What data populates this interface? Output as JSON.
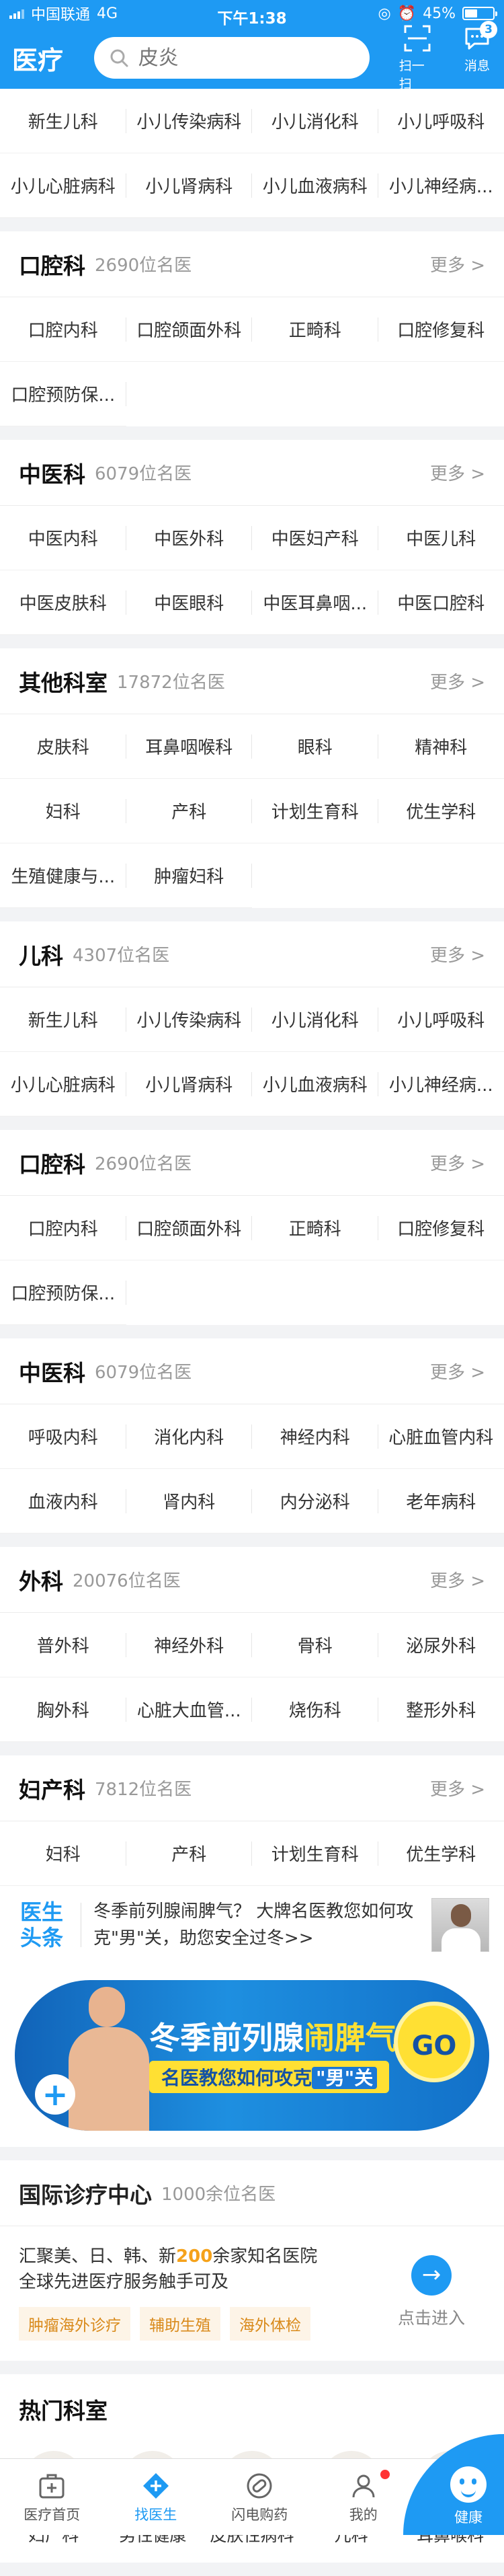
{
  "status_bar": {
    "carrier": "中国联通",
    "network": "4G",
    "time": "下午1:38",
    "battery": "45%"
  },
  "header": {
    "title": "医疗",
    "search_placeholder": "皮炎",
    "scan_label": "扫一扫",
    "message_label": "消息",
    "message_badge": "3"
  },
  "top_depts": [
    "新生儿科",
    "小儿传染病科",
    "小儿消化科",
    "小儿呼吸科",
    "小儿心脏病科",
    "小儿肾病科",
    "小儿血液病科",
    "小儿神经病..."
  ],
  "sections": [
    {
      "title": "口腔科",
      "count": "2690位名医",
      "more": "更多 >",
      "items": [
        "口腔内科",
        "口腔颌面外科",
        "正畸科",
        "口腔修复科",
        "口腔预防保..."
      ]
    },
    {
      "title": "中医科",
      "count": "6079位名医",
      "more": "更多 >",
      "items": [
        "中医内科",
        "中医外科",
        "中医妇产科",
        "中医儿科",
        "中医皮肤科",
        "中医眼科",
        "中医耳鼻咽...",
        "中医口腔科"
      ]
    },
    {
      "title": "其他科室",
      "count": "17872位名医",
      "more": "更多 >",
      "items": [
        "皮肤科",
        "耳鼻咽喉科",
        "眼科",
        "精神科",
        "妇科",
        "产科",
        "计划生育科",
        "优生学科",
        "生殖健康与...",
        "肿瘤妇科"
      ]
    },
    {
      "title": "儿科",
      "count": "4307位名医",
      "more": "更多 >",
      "items": [
        "新生儿科",
        "小儿传染病科",
        "小儿消化科",
        "小儿呼吸科",
        "小儿心脏病科",
        "小儿肾病科",
        "小儿血液病科",
        "小儿神经病..."
      ]
    },
    {
      "title": "口腔科",
      "count": "2690位名医",
      "more": "更多 >",
      "items": [
        "口腔内科",
        "口腔颌面外科",
        "正畸科",
        "口腔修复科",
        "口腔预防保..."
      ]
    },
    {
      "title": "中医科",
      "count": "6079位名医",
      "more": "更多 >",
      "items": [
        "呼吸内科",
        "消化内科",
        "神经内科",
        "心脏血管内科",
        "血液内科",
        "肾内科",
        "内分泌科",
        "老年病科"
      ]
    },
    {
      "title": "外科",
      "count": "20076位名医",
      "more": "更多 >",
      "items": [
        "普外科",
        "神经外科",
        "骨科",
        "泌尿外科",
        "胸外科",
        "心脏大血管...",
        "烧伤科",
        "整形外科"
      ]
    },
    {
      "title": "妇产科",
      "count": "7812位名医",
      "more": "更多 >",
      "items": [
        "妇科",
        "产科",
        "计划生育科",
        "优生学科"
      ]
    }
  ],
  "headline": {
    "logo_line1": "医生",
    "logo_line2": "头条",
    "text": "冬季前列腺闹脾气？ 大牌名医教您如何攻克\"男\"关，助您安全过冬>>"
  },
  "banner": {
    "title_pre": "冬季前列腺",
    "title_hl": "闹脾气？",
    "sub_pre": "名医教您如何攻克",
    "sub_hl": "\"男\"关",
    "go": "GO"
  },
  "international": {
    "title": "国际诊疗中心",
    "count": "1000余位名医",
    "desc_pre": "汇聚美、日、韩、新",
    "desc_num": "200",
    "desc_post": "余家知名医院",
    "desc_line2": "全球先进医疗服务触手可及",
    "tags": [
      "肿瘤海外诊疗",
      "辅助生殖",
      "海外体检"
    ],
    "enter": "点击进入",
    "arrow": "→"
  },
  "hot": {
    "title": "热门科室",
    "items": [
      "妇产科",
      "男性健康",
      "皮肤性病科",
      "儿科",
      "耳鼻喉科"
    ]
  },
  "tabbar": {
    "tabs": [
      "医疗首页",
      "找医生",
      "闪电购药",
      "我的"
    ],
    "health": "健康"
  },
  "colors": {
    "primary": "#1e9af3",
    "accent_yellow": "#ffe033",
    "tag_orange": "#d98a1b"
  }
}
